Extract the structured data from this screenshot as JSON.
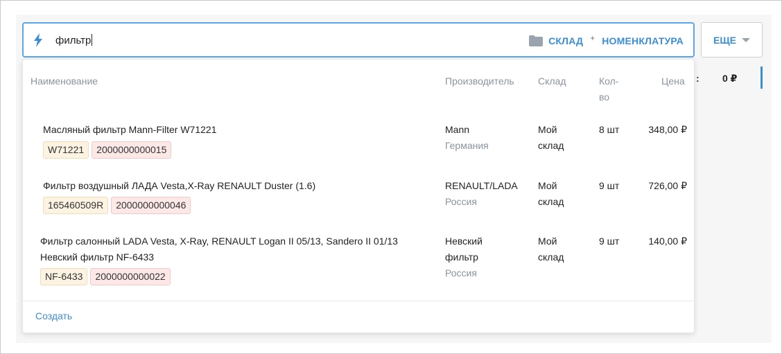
{
  "search": {
    "query": "фильтр",
    "scope_primary": "СКЛАД",
    "scope_plus": "+",
    "scope_secondary": "НОМЕНКЛАТУРА"
  },
  "more_button": {
    "label": "ЕЩЕ"
  },
  "total": {
    "colon": ":",
    "value": "0 ₽"
  },
  "table": {
    "headers": {
      "name": "Наименование",
      "manufacturer": "Производитель",
      "warehouse": "Склад",
      "qty_line1": "Кол-",
      "qty_line2": "во",
      "price": "Цена"
    },
    "rows": [
      {
        "name": "Масляный фильтр Mann-Filter W71221",
        "sku": "W71221",
        "barcode": "2000000000015",
        "manufacturer": "Mann",
        "country": "Германия",
        "warehouse_line1": "Мой",
        "warehouse_line2": "склад",
        "qty": "8 шт",
        "price": "348,00 ₽"
      },
      {
        "name": "Фильтр воздушный ЛАДА Vesta,X-Ray RENAULT Duster (1.6)",
        "sku": "165460509R",
        "barcode": "2000000000046",
        "manufacturer": "RENAULT/LADA",
        "country": "Россия",
        "warehouse_line1": "Мой",
        "warehouse_line2": "склад",
        "qty": "9 шт",
        "price": "726,00 ₽"
      },
      {
        "name_line1": "Фильтр салонный LADA Vesta, X-Ray, RENAULT Logan II 05/13, Sandero II 01/13",
        "name_line2": "Невский фильтр NF-6433",
        "sku": "NF-6433",
        "barcode": "2000000000022",
        "manufacturer_line1": "Невский",
        "manufacturer_line2": "фильтр",
        "country": "Россия",
        "warehouse_line1": "Мой",
        "warehouse_line2": "склад",
        "qty": "9 шт",
        "price": "140,00 ₽"
      }
    ]
  },
  "footer": {
    "create_label": "Создать"
  },
  "colors": {
    "accent": "#3b8ed6",
    "focus_border": "#5aa6e8",
    "muted_text": "#8a949e",
    "sku_tag_bg": "#fdf3e2",
    "barcode_tag_bg": "#fde8e8"
  },
  "icons": {
    "search_mode": "lightning-bolt-icon",
    "scope": "folder-icon",
    "more": "triangle-down-icon"
  }
}
